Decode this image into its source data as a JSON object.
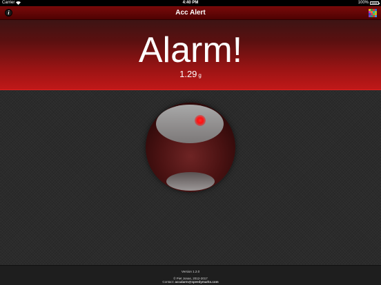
{
  "status_bar": {
    "carrier": "Carrier",
    "time": "4:40 PM",
    "battery": "100%"
  },
  "nav": {
    "title": "Acc Alert",
    "info_icon": "info-icon",
    "grid_icon": "color-grid-icon"
  },
  "alarm": {
    "title": "Alarm!",
    "value": "1.29",
    "unit": "g"
  },
  "footer": {
    "version": "Version 1.2.0",
    "copyright": "© Piet Jonas, 2012-2017",
    "contact_label": "Contact:",
    "contact_email": "accalarm@speedymarks.com"
  },
  "colors": {
    "nav_bar": "#6a0606",
    "banner_top": "#3d1414",
    "banner_bottom": "#c01818",
    "background": "#2b2b2b",
    "alert_dot": "#ff2020"
  }
}
